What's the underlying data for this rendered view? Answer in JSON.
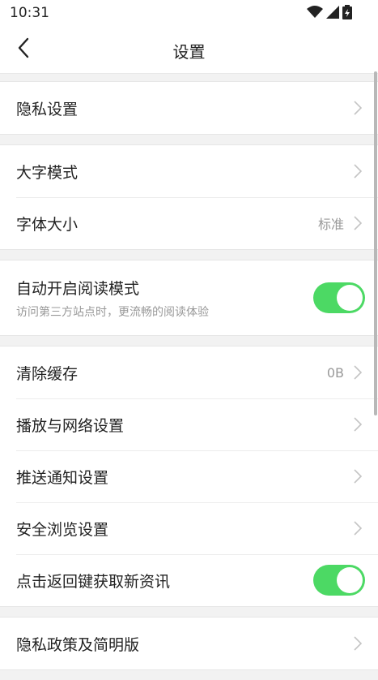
{
  "status": {
    "time": "10:31"
  },
  "header": {
    "title": "设置"
  },
  "groups": [
    {
      "items": [
        {
          "label": "隐私设置"
        }
      ]
    },
    {
      "items": [
        {
          "label": "大字模式"
        },
        {
          "label": "字体大小",
          "value": "标准"
        }
      ]
    },
    {
      "items": [
        {
          "label": "自动开启阅读模式",
          "subtitle": "访问第三方站点时，更流畅的阅读体验",
          "toggle": true
        }
      ]
    },
    {
      "items": [
        {
          "label": "清除缓存",
          "value": "0B"
        },
        {
          "label": "播放与网络设置"
        },
        {
          "label": "推送通知设置"
        },
        {
          "label": "安全浏览设置"
        },
        {
          "label": "点击返回键获取新资讯",
          "toggle": true
        }
      ]
    },
    {
      "items": [
        {
          "label": "隐私政策及简明版"
        }
      ]
    }
  ],
  "colors": {
    "toggle_on": "#4cd964",
    "background": "#f2f2f2"
  },
  "icons": [
    "wifi-icon",
    "signal-icon",
    "battery-icon",
    "back-arrow-icon",
    "chevron-right-icon"
  ]
}
